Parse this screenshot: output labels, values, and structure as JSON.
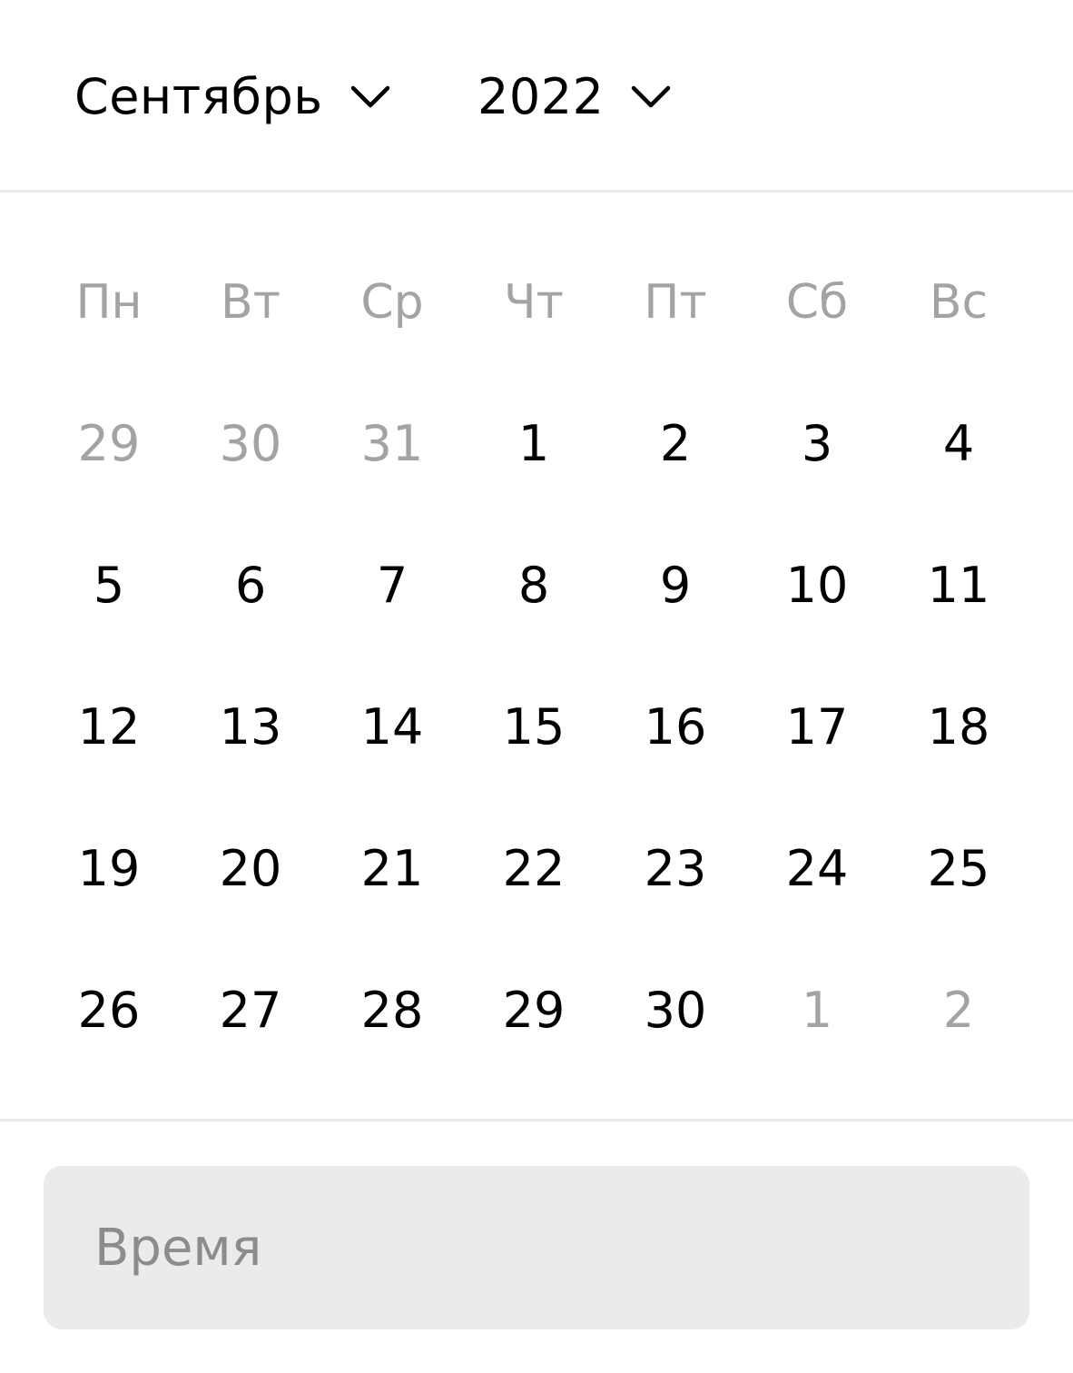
{
  "header": {
    "month": "Сентябрь",
    "year": "2022",
    "month_icon": "chevron-down-icon",
    "year_icon": "chevron-down-icon"
  },
  "weekdays": [
    "Пн",
    "Вт",
    "Ср",
    "Чт",
    "Пт",
    "Сб",
    "Вс"
  ],
  "weeks": [
    [
      {
        "label": "29",
        "outside": true
      },
      {
        "label": "30",
        "outside": true
      },
      {
        "label": "31",
        "outside": true
      },
      {
        "label": "1",
        "outside": false
      },
      {
        "label": "2",
        "outside": false
      },
      {
        "label": "3",
        "outside": false
      },
      {
        "label": "4",
        "outside": false
      }
    ],
    [
      {
        "label": "5",
        "outside": false
      },
      {
        "label": "6",
        "outside": false
      },
      {
        "label": "7",
        "outside": false
      },
      {
        "label": "8",
        "outside": false
      },
      {
        "label": "9",
        "outside": false
      },
      {
        "label": "10",
        "outside": false
      },
      {
        "label": "11",
        "outside": false
      }
    ],
    [
      {
        "label": "12",
        "outside": false
      },
      {
        "label": "13",
        "outside": false
      },
      {
        "label": "14",
        "outside": false
      },
      {
        "label": "15",
        "outside": false
      },
      {
        "label": "16",
        "outside": false
      },
      {
        "label": "17",
        "outside": false
      },
      {
        "label": "18",
        "outside": false
      }
    ],
    [
      {
        "label": "19",
        "outside": false
      },
      {
        "label": "20",
        "outside": false
      },
      {
        "label": "21",
        "outside": false
      },
      {
        "label": "22",
        "outside": false
      },
      {
        "label": "23",
        "outside": false
      },
      {
        "label": "24",
        "outside": false
      },
      {
        "label": "25",
        "outside": false
      }
    ],
    [
      {
        "label": "26",
        "outside": false
      },
      {
        "label": "27",
        "outside": false
      },
      {
        "label": "28",
        "outside": false
      },
      {
        "label": "29",
        "outside": false
      },
      {
        "label": "30",
        "outside": false
      },
      {
        "label": "1",
        "outside": true
      },
      {
        "label": "2",
        "outside": true
      }
    ]
  ],
  "time": {
    "placeholder": "Время",
    "value": ""
  },
  "colors": {
    "text": "#000000",
    "muted": "#a3a3a3",
    "field_bg": "#ebebeb",
    "divider": "#ebebeb"
  }
}
